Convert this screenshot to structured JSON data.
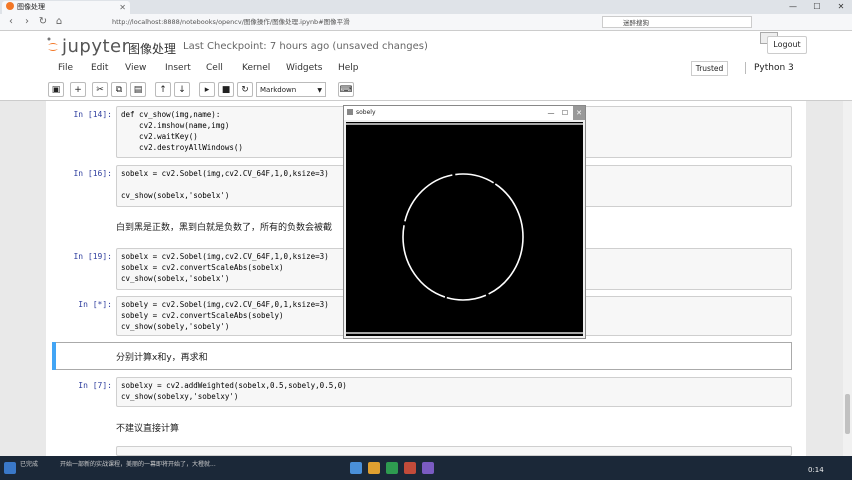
{
  "browser": {
    "tab_title": "图像处理",
    "url": "http://localhost:8888/notebooks/opencv/图像操作/图像处理.ipynb#图像平滑",
    "search_text": "迷醉搜狗"
  },
  "jupyter": {
    "logo_text": "jupyter",
    "notebook_name": "图像处理",
    "checkpoint": "Last Checkpoint: 7 hours ago (unsaved changes)",
    "logout_label": "Logout",
    "trusted_label": "Trusted",
    "kernel_name": "Python 3",
    "menu": [
      "File",
      "Edit",
      "View",
      "Insert",
      "Cell",
      "Kernel",
      "Widgets",
      "Help"
    ],
    "cell_type": "Markdown"
  },
  "cells": [
    {
      "prompt": "In [14]:",
      "code": "def cv_show(img,name):\n    cv2.imshow(name,img)\n    cv2.waitKey()\n    cv2.destroyAllWindows()"
    },
    {
      "prompt": "In [16]:",
      "code": "sobelx = cv2.Sobel(img,cv2.CV_64F,1,0,ksize=3)\n\ncv_show(sobelx,'sobelx')"
    },
    {
      "markdown": "白到黑是正数，黑到白就是负数了，所有的负数会被截"
    },
    {
      "prompt": "In [19]:",
      "code": "sobelx = cv2.Sobel(img,cv2.CV_64F,1,0,ksize=3)\nsobelx = cv2.convertScaleAbs(sobelx)\ncv_show(sobelx,'sobelx')"
    },
    {
      "prompt": "In [*]:",
      "code": "sobely = cv2.Sobel(img,cv2.CV_64F,0,1,ksize=3)\nsobely = cv2.convertScaleAbs(sobely)\ncv_show(sobely,'sobely')"
    },
    {
      "markdown": "分别计算x和y，再求和"
    },
    {
      "prompt": "In [7]:",
      "code": "sobelxy = cv2.addWeighted(sobelx,0.5,sobely,0.5,0)\ncv_show(sobelxy,'sobelxy')"
    },
    {
      "markdown": "不建议直接计算"
    }
  ],
  "cv_window": {
    "title": "sobely"
  },
  "taskbar": {
    "status": "已完成",
    "message": "开始一部新的实战课程，美丽的一幕即将开始了，大橙就...",
    "time": "0:14"
  },
  "colors": {
    "accent": "#42a5f5",
    "prompt": "#303f9f",
    "jupyter_orange": "#f37726"
  }
}
